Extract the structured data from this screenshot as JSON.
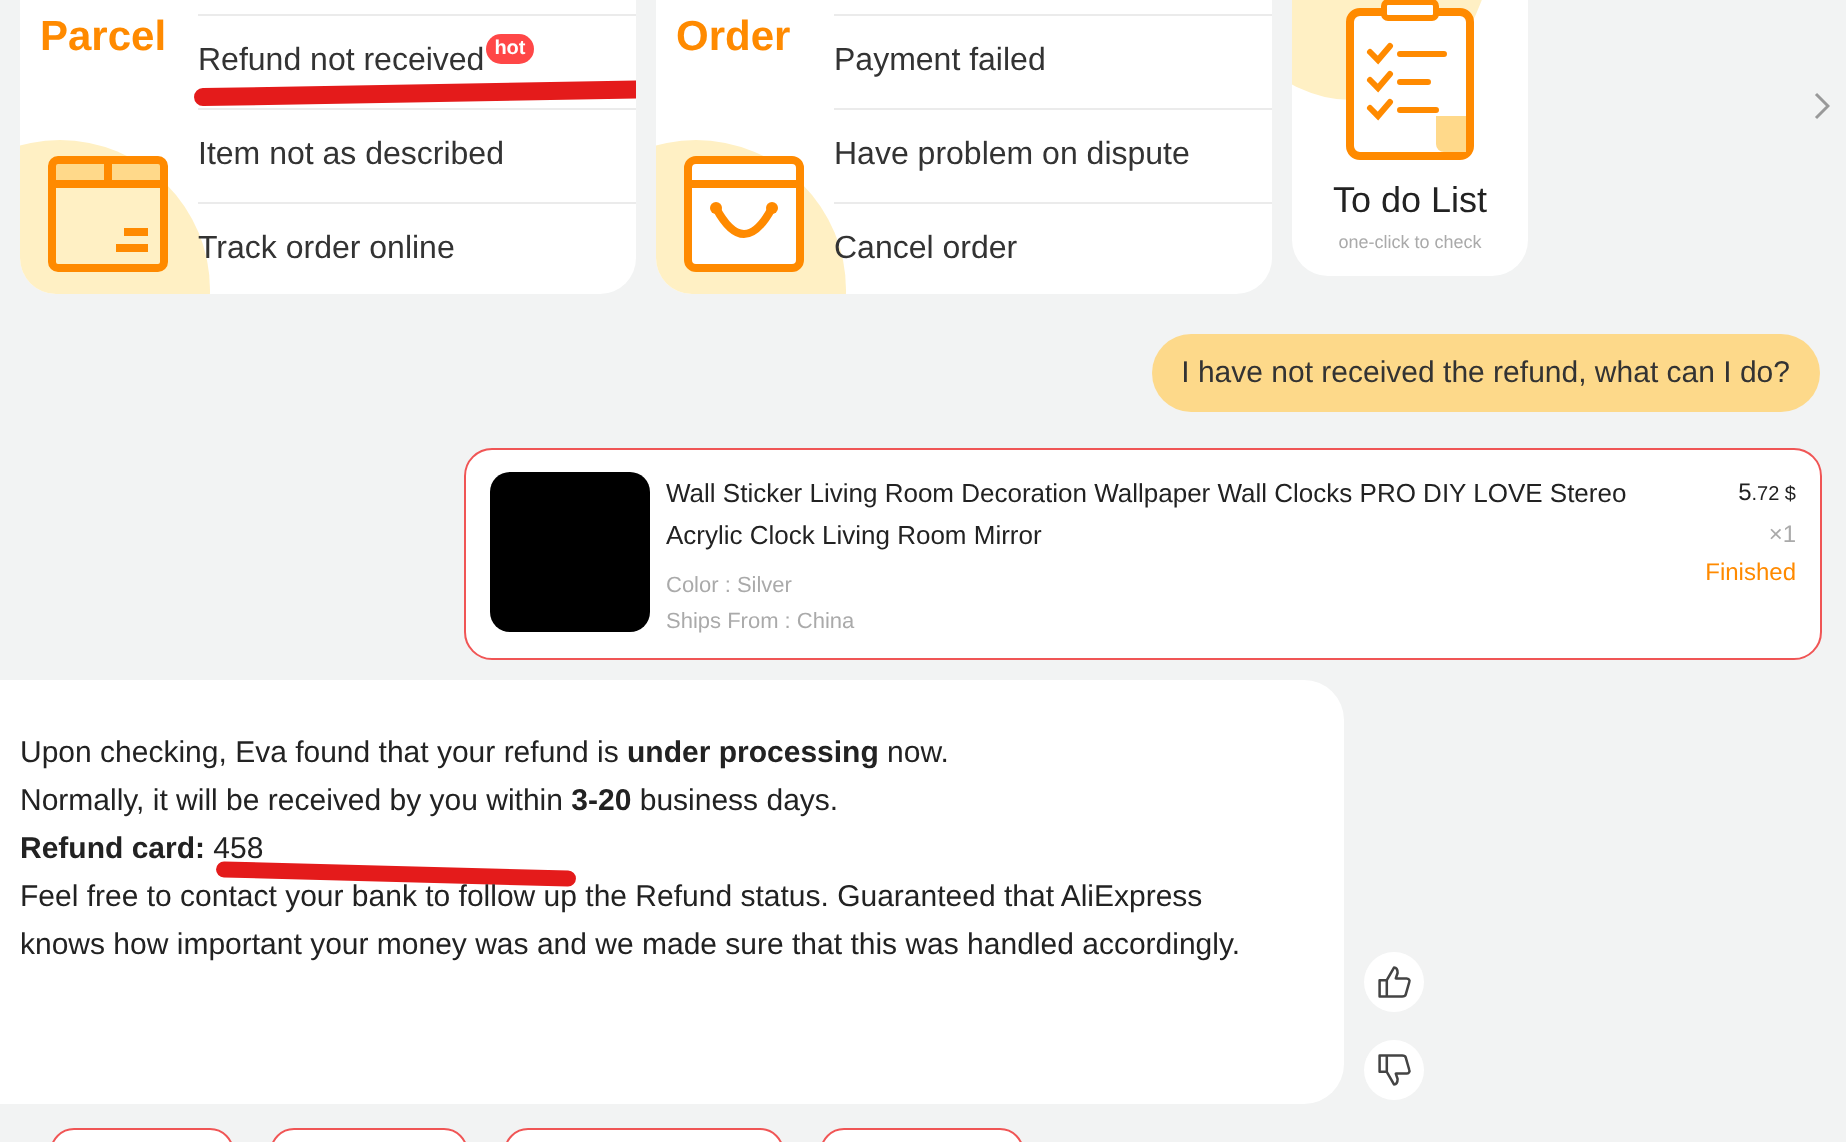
{
  "cards": [
    {
      "kind": "parcel",
      "title": "Parcel",
      "items": [
        {
          "label": "Refund not received",
          "badge": "hot",
          "scribbled": true
        },
        {
          "label": "Item not as described",
          "scribbled": false
        },
        {
          "label": "Track order online",
          "scribbled": false
        }
      ]
    },
    {
      "kind": "order",
      "title": "Order",
      "items": [
        {
          "label": "Payment failed",
          "scribbled": false
        },
        {
          "label": "Have problem on dispute",
          "scribbled": false
        },
        {
          "label": "Cancel order",
          "scribbled": false
        }
      ]
    }
  ],
  "todo": {
    "title": "To do List",
    "subtitle": "one-click to check"
  },
  "user_message": "I have not received the refund, what can I do?",
  "product": {
    "title": "Wall Sticker Living Room Decoration Wallpaper Wall Clocks PRO DIY LOVE Stereo Acrylic Clock Living Room Mirror",
    "color_option": "Color : Silver",
    "ships_from": "Ships From : China",
    "price_int": "5",
    "price_dec": ".72 $",
    "quantity": "×1",
    "status": "Finished"
  },
  "bot_message": {
    "lines": [
      {
        "text": "Upon checking, Eva found that your refund is **under processing** now.",
        "scribbled": false
      },
      {
        "text": "Normally, it will be received by you within **3-20** business days.",
        "scribbled": false
      },
      {
        "text": "**Refund card:** 458",
        "scribbled": true
      },
      {
        "text": "Feel free to contact your bank to follow up the Refund status. Guaranteed that AliExpress knows how important your money was and we made sure that this was handled accordingly.",
        "scribbled": false
      }
    ]
  },
  "quick_replies": [
    {
      "kind": "pill"
    },
    {
      "kind": "pill"
    },
    {
      "kind": "pill"
    },
    {
      "kind": "pill"
    }
  ]
}
